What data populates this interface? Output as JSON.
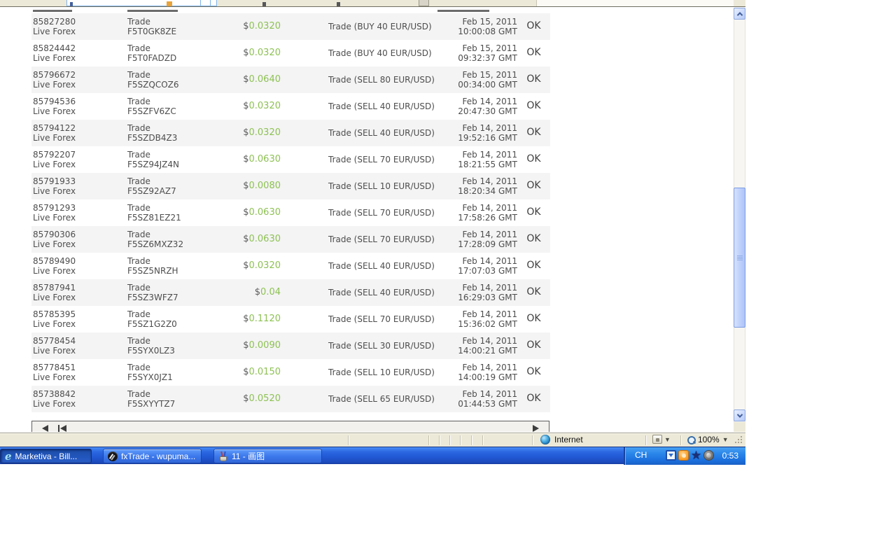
{
  "colors": {
    "amount_green": "#8dc153",
    "taskbar_blue": "#245edb",
    "chrome_beige": "#ece9d8"
  },
  "browser": {
    "pager": {
      "icons": [
        "page-left-icon",
        "page-first-icon",
        "page-right-icon"
      ]
    },
    "statusbar": {
      "zone_icon": "globe-icon",
      "zone_label": "Internet",
      "security_icon": "security-zone-icon",
      "zoom_icon": "magnifier-icon",
      "zoom_level": "100%"
    }
  },
  "taskbar": {
    "buttons": [
      {
        "label": "Marketiva - Bill...",
        "icon": "ie-icon",
        "active": true
      },
      {
        "label": "fxTrade - wupuma...",
        "icon": "fxtrade-icon",
        "active": false
      },
      {
        "label": "11 - 画图",
        "icon": "paint-icon",
        "active": false
      }
    ],
    "tray": {
      "language": "CH",
      "icons": [
        "messenger-icon",
        "orange-avatar-icon",
        "star-icon",
        "webcam-icon"
      ],
      "clock": "0:53"
    }
  },
  "table": {
    "rows": [
      {
        "id": "85827280",
        "account": "Live Forex",
        "type": "Trade",
        "code": "F5T0GK8ZE",
        "currency": "$",
        "amount": "0.0320",
        "description": "Trade (BUY 40 EUR/USD)",
        "date": "Feb 15, 2011",
        "time": "10:00:08 GMT",
        "status": "OK"
      },
      {
        "id": "85824442",
        "account": "Live Forex",
        "type": "Trade",
        "code": "F5T0FADZD",
        "currency": "$",
        "amount": "0.0320",
        "description": "Trade (BUY 40 EUR/USD)",
        "date": "Feb 15, 2011",
        "time": "09:32:37 GMT",
        "status": "OK"
      },
      {
        "id": "85796672",
        "account": "Live Forex",
        "type": "Trade",
        "code": "F5SZQCOZ6",
        "currency": "$",
        "amount": "0.0640",
        "description": "Trade (SELL 80 EUR/USD)",
        "date": "Feb 15, 2011",
        "time": "00:34:00 GMT",
        "status": "OK"
      },
      {
        "id": "85794536",
        "account": "Live Forex",
        "type": "Trade",
        "code": "F5SZFV6ZC",
        "currency": "$",
        "amount": "0.0320",
        "description": "Trade (SELL 40 EUR/USD)",
        "date": "Feb 14, 2011",
        "time": "20:47:30 GMT",
        "status": "OK"
      },
      {
        "id": "85794122",
        "account": "Live Forex",
        "type": "Trade",
        "code": "F5SZDB4Z3",
        "currency": "$",
        "amount": "0.0320",
        "description": "Trade (SELL 40 EUR/USD)",
        "date": "Feb 14, 2011",
        "time": "19:52:16 GMT",
        "status": "OK"
      },
      {
        "id": "85792207",
        "account": "Live Forex",
        "type": "Trade",
        "code": "F5SZ94JZ4N",
        "currency": "$",
        "amount": "0.0630",
        "description": "Trade (SELL 70 EUR/USD)",
        "date": "Feb 14, 2011",
        "time": "18:21:55 GMT",
        "status": "OK"
      },
      {
        "id": "85791933",
        "account": "Live Forex",
        "type": "Trade",
        "code": "F5SZ92AZ7",
        "currency": "$",
        "amount": "0.0080",
        "description": "Trade (SELL 10 EUR/USD)",
        "date": "Feb 14, 2011",
        "time": "18:20:34 GMT",
        "status": "OK"
      },
      {
        "id": "85791293",
        "account": "Live Forex",
        "type": "Trade",
        "code": "F5SZ81EZ21",
        "currency": "$",
        "amount": "0.0630",
        "description": "Trade (SELL 70 EUR/USD)",
        "date": "Feb 14, 2011",
        "time": "17:58:26 GMT",
        "status": "OK"
      },
      {
        "id": "85790306",
        "account": "Live Forex",
        "type": "Trade",
        "code": "F5SZ6MXZ32",
        "currency": "$",
        "amount": "0.0630",
        "description": "Trade (SELL 70 EUR/USD)",
        "date": "Feb 14, 2011",
        "time": "17:28:09 GMT",
        "status": "OK"
      },
      {
        "id": "85789490",
        "account": "Live Forex",
        "type": "Trade",
        "code": "F5SZ5NRZH",
        "currency": "$",
        "amount": "0.0320",
        "description": "Trade (SELL 40 EUR/USD)",
        "date": "Feb 14, 2011",
        "time": "17:07:03 GMT",
        "status": "OK"
      },
      {
        "id": "85787941",
        "account": "Live Forex",
        "type": "Trade",
        "code": "F5SZ3WFZ7",
        "currency": "$",
        "amount": "0.04",
        "description": "Trade (SELL 40 EUR/USD)",
        "date": "Feb 14, 2011",
        "time": "16:29:03 GMT",
        "status": "OK"
      },
      {
        "id": "85785395",
        "account": "Live Forex",
        "type": "Trade",
        "code": "F5SZ1G2Z0",
        "currency": "$",
        "amount": "0.1120",
        "description": "Trade (SELL 70 EUR/USD)",
        "date": "Feb 14, 2011",
        "time": "15:36:02 GMT",
        "status": "OK"
      },
      {
        "id": "85778454",
        "account": "Live Forex",
        "type": "Trade",
        "code": "F5SYX0LZ3",
        "currency": "$",
        "amount": "0.0090",
        "description": "Trade (SELL 30 EUR/USD)",
        "date": "Feb 14, 2011",
        "time": "14:00:21 GMT",
        "status": "OK"
      },
      {
        "id": "85778451",
        "account": "Live Forex",
        "type": "Trade",
        "code": "F5SYX0JZ1",
        "currency": "$",
        "amount": "0.0150",
        "description": "Trade (SELL 10 EUR/USD)",
        "date": "Feb 14, 2011",
        "time": "14:00:19 GMT",
        "status": "OK"
      },
      {
        "id": "85738842",
        "account": "Live Forex",
        "type": "Trade",
        "code": "F5SXYYTZ7",
        "currency": "$",
        "amount": "0.0520",
        "description": "Trade (SELL 65 EUR/USD)",
        "date": "Feb 14, 2011",
        "time": "01:44:53 GMT",
        "status": "OK"
      }
    ]
  }
}
